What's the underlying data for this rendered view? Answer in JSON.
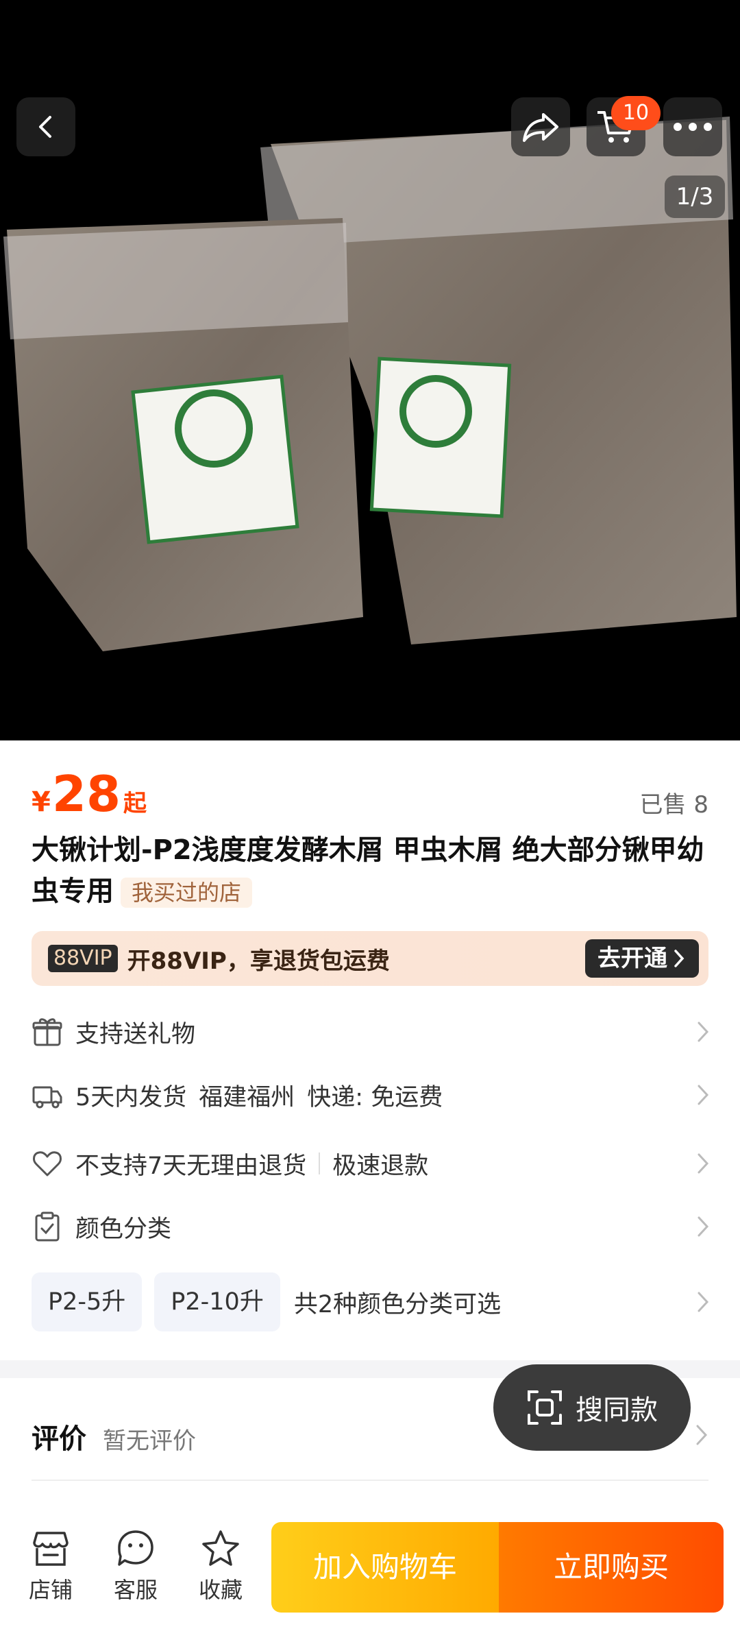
{
  "header": {
    "cart_count": "10",
    "image_indicator": "1/3"
  },
  "product": {
    "price_symbol": "¥",
    "price": "28",
    "price_suffix": "起",
    "sold": "已售 8",
    "title": "大锹计划-P2浅度度发酵木屑 甲虫木屑 绝大部分锹甲幼虫专用",
    "bought_tag": "我买过的店"
  },
  "vip": {
    "badge": "88VIP",
    "text": "开88VIP，享退货包运费",
    "cta": "去开通"
  },
  "services": {
    "gift": "支持送礼物",
    "shipping_time": "5天内发货",
    "shipping_origin": "福建福州",
    "shipping_fee": "快递: 免运费",
    "return_policy": "不支持7天无理由退货",
    "refund": "极速退款",
    "color_category": "颜色分类"
  },
  "variants": {
    "options": [
      "P2-5升",
      "P2-10升"
    ],
    "note": "共2种颜色分类可选"
  },
  "review": {
    "title": "评价",
    "subtitle": "暂无评价"
  },
  "float_button": {
    "label": "搜同款"
  },
  "bottom_bar": {
    "store": "店铺",
    "service": "客服",
    "favorite": "收藏",
    "add_to_cart": "加入购物车",
    "buy_now": "立即购买"
  },
  "colors": {
    "price": "#ff4400",
    "badge": "#ff4d1a",
    "cart_button": "#ffaa00",
    "buy_button": "#ff4d00"
  }
}
